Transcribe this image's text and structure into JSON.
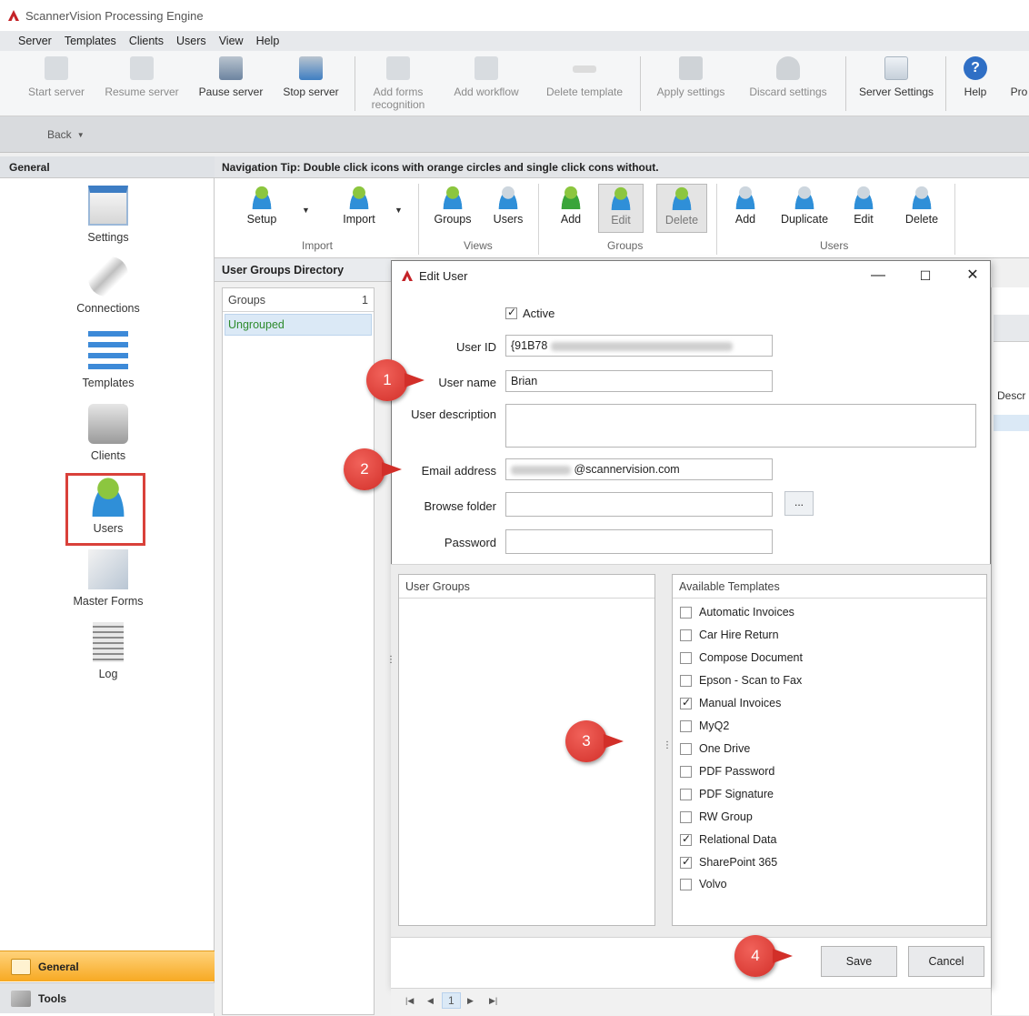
{
  "app": {
    "title": "ScannerVision Processing Engine"
  },
  "menu": [
    "Server",
    "Templates",
    "Clients",
    "Users",
    "View",
    "Help"
  ],
  "toolbar": {
    "start": "Start server",
    "resume": "Resume server",
    "pause": "Pause server",
    "stop": "Stop server",
    "add_forms_1": "Add forms",
    "add_forms_2": "recognition",
    "add_workflow": "Add workflow",
    "delete_template": "Delete template",
    "apply": "Apply settings",
    "discard": "Discard settings",
    "server_settings": "Server Settings",
    "help": "Help",
    "overflow": "Pro"
  },
  "back": {
    "label": "Back"
  },
  "leftnav": {
    "header": "General",
    "items": [
      "Settings",
      "Connections",
      "Templates",
      "Clients",
      "Users",
      "Master Forms",
      "Log"
    ],
    "bottom": [
      "General",
      "Tools"
    ]
  },
  "tip": "Navigation Tip: Double click icons with orange circles and single click cons without.",
  "ribbon": {
    "setup": "Setup",
    "import": "Import",
    "groups": "Groups",
    "users": "Users",
    "g_add": "Add",
    "g_edit": "Edit",
    "g_delete": "Delete",
    "u_add": "Add",
    "u_duplicate": "Duplicate",
    "u_edit": "Edit",
    "u_delete": "Delete",
    "group_import": "Import",
    "group_views": "Views",
    "group_groups": "Groups",
    "group_users": "Users"
  },
  "directory": {
    "title": "User Groups Directory",
    "groups_label": "Groups",
    "groups_count": "1",
    "ungrouped": "Ungrouped",
    "descr": "Descr"
  },
  "dialog": {
    "title": "Edit User",
    "active_label": "Active",
    "user_id_label": "User ID",
    "user_id_value": "{91B78",
    "user_name_label": "User name",
    "user_name_value": "Brian",
    "user_desc_label": "User description",
    "email_label": "Email address",
    "email_value": "@scannervision.com",
    "browse_label": "Browse folder",
    "browse_btn": "...",
    "password_label": "Password",
    "user_groups": "User Groups",
    "available_templates": "Available Templates",
    "templates": [
      {
        "name": "Automatic Invoices",
        "checked": false
      },
      {
        "name": "Car Hire Return",
        "checked": false
      },
      {
        "name": "Compose Document",
        "checked": false
      },
      {
        "name": "Epson - Scan to Fax",
        "checked": false
      },
      {
        "name": "Manual Invoices",
        "checked": true
      },
      {
        "name": "MyQ2",
        "checked": false
      },
      {
        "name": "One Drive",
        "checked": false
      },
      {
        "name": "PDF Password",
        "checked": false
      },
      {
        "name": "PDF Signature",
        "checked": false
      },
      {
        "name": "RW Group",
        "checked": false
      },
      {
        "name": "Relational Data",
        "checked": true
      },
      {
        "name": "SharePoint 365",
        "checked": true
      },
      {
        "name": "Volvo",
        "checked": false
      }
    ],
    "save": "Save",
    "cancel": "Cancel"
  },
  "pager": {
    "page": "1"
  },
  "badges": [
    "1",
    "2",
    "3",
    "4"
  ],
  "colors": {
    "accent": "#f7a922",
    "badge": "#d22f29",
    "highlight": "#d9413a"
  }
}
